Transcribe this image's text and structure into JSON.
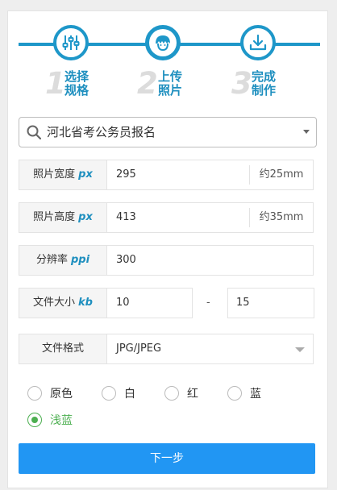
{
  "steps": [
    {
      "num": "1",
      "line1": "选择",
      "line2": "规格",
      "icon": "sliders-icon"
    },
    {
      "num": "2",
      "line1": "上传",
      "line2": "照片",
      "icon": "person-icon"
    },
    {
      "num": "3",
      "line1": "完成",
      "line2": "制作",
      "icon": "download-icon"
    }
  ],
  "search": {
    "value": "河北省考公务员报名"
  },
  "fields": {
    "width": {
      "label": "照片宽度",
      "unit": "px",
      "value": "295",
      "suffix": "约25mm"
    },
    "height": {
      "label": "照片高度",
      "unit": "px",
      "value": "413",
      "suffix": "约35mm"
    },
    "dpi": {
      "label": "分辨率",
      "unit": "ppi",
      "value": "300"
    },
    "filesize": {
      "label": "文件大小",
      "unit": "kb",
      "min": "10",
      "separator": "-",
      "max": "15"
    },
    "format": {
      "label": "文件格式",
      "value": "JPG/JPEG"
    }
  },
  "background": {
    "options": [
      "原色",
      "白",
      "红",
      "蓝",
      "浅蓝"
    ],
    "selected": "浅蓝"
  },
  "next_label": "下一步",
  "colors": {
    "accent": "#1e97c9",
    "button": "#2196f3",
    "selected": "#4caf50"
  }
}
